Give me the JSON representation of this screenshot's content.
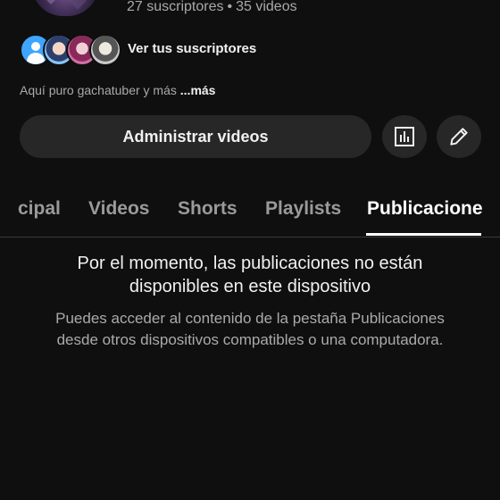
{
  "channel": {
    "subscribers": "27 suscriptores",
    "separator": "•",
    "videos": "35 videos",
    "subscribers_link": "Ver tus suscriptores",
    "description": "Aquí puro gachatuber y más",
    "more_label": "...más"
  },
  "actions": {
    "manage_label": "Administrar videos",
    "stats_icon": "analytics-icon",
    "edit_icon": "pencil-icon"
  },
  "tabs": [
    {
      "label": "cipal"
    },
    {
      "label": "Videos"
    },
    {
      "label": "Shorts"
    },
    {
      "label": "Playlists"
    },
    {
      "label": "Publicacione",
      "active": true
    }
  ],
  "message": {
    "title_line1": "Por el momento, las publicaciones no están",
    "title_line2": "disponibles en este dispositivo",
    "body_line1": "Puedes acceder al contenido de la pestaña Publicaciones",
    "body_line2": "desde otros dispositivos compatibles o una computadora."
  },
  "colors": {
    "background": "#0f0f0f",
    "surface": "#272727",
    "text_primary": "#f1f1f1",
    "text_secondary": "#aaaaaa",
    "accent_avatar": "#3ea6ff"
  }
}
